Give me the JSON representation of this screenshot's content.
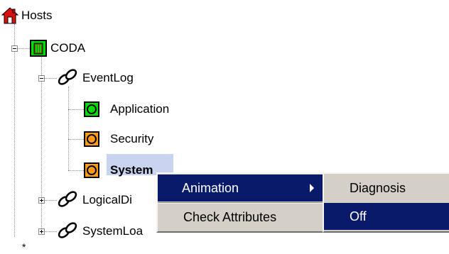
{
  "tree": {
    "root_label": "Hosts",
    "host_label": "CODA",
    "eventlog_label": "EventLog",
    "application_label": "Application",
    "security_label": "Security",
    "system_label": "System",
    "logicaldisk_label": "LogicalDi",
    "systemload_label": "SystemLoa",
    "footer_mark": "*"
  },
  "colors": {
    "status_ok": "#00dd00",
    "status_warning": "#ff9a1a",
    "selection_bg": "#c8d4f0",
    "menu_active": "#0a1a6b"
  },
  "context_menu": {
    "items": [
      {
        "label": "Animation"
      },
      {
        "label": "Check Attributes"
      }
    ]
  },
  "submenu": {
    "items": [
      {
        "label": "Diagnosis"
      },
      {
        "label": "Off"
      }
    ]
  }
}
